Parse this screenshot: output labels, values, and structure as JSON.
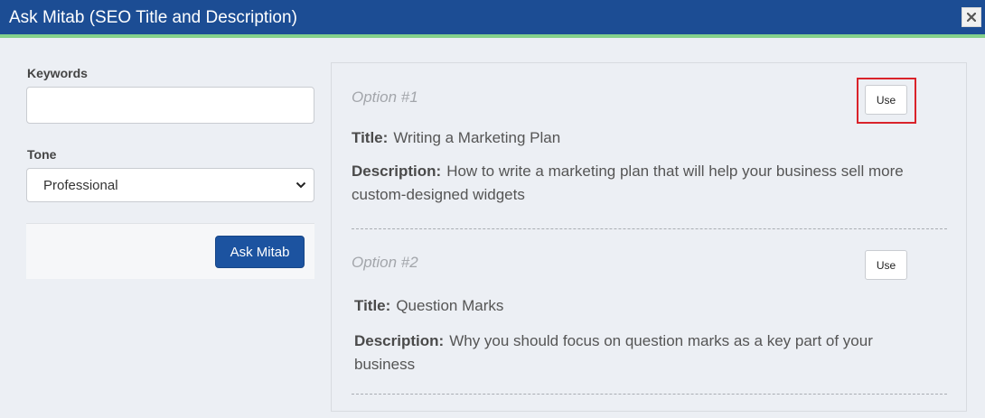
{
  "dialog": {
    "title": "Ask Mitab (SEO Title and Description)",
    "close_icon": "close-icon"
  },
  "form": {
    "keywords_label": "Keywords",
    "keywords_value": "",
    "tone_label": "Tone",
    "tone_value": "Professional",
    "submit_label": "Ask Mitab"
  },
  "options": [
    {
      "label": "Option #1",
      "use_label": "Use",
      "title_label": "Title:",
      "title_value": "Writing a Marketing Plan",
      "description_label": "Description:",
      "description_value": "How to write a marketing plan that will help your business sell more custom-designed widgets"
    },
    {
      "label": "Option #2",
      "use_label": "Use",
      "title_label": "Title:",
      "title_value": "Question Marks",
      "description_label": "Description:",
      "description_value": "Why you should focus on question marks as a key part of your business"
    }
  ],
  "colors": {
    "header": "#1c4d94",
    "header_accent": "#84d18b",
    "primary_button": "#1c53a0",
    "highlight": "#d9232a"
  }
}
